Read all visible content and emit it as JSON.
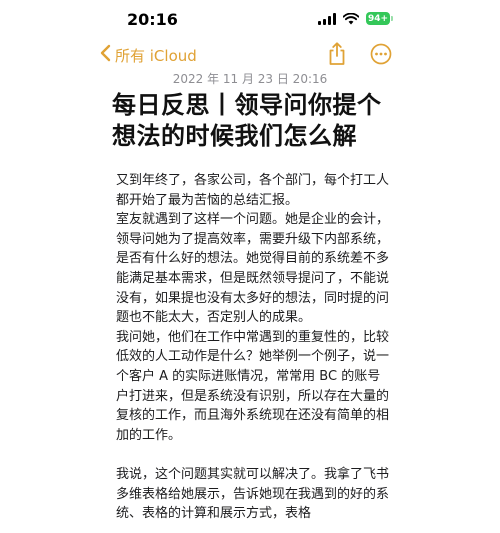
{
  "status_bar": {
    "time": "20:16",
    "battery": "94+",
    "icons": [
      "cellular-signal-icon",
      "wifi-icon",
      "battery-icon"
    ]
  },
  "nav": {
    "back_label": "所有 iCloud",
    "back_icon": "chevron-left-icon",
    "share_icon": "share-icon",
    "more_icon": "more-icon",
    "accent_color": "#e0a235"
  },
  "note": {
    "date": "2022 年 11 月 23 日 20:16",
    "title": "每日反思丨领导问你提个想法的时候我们怎么解",
    "paragraphs": [
      "又到年终了，各家公司，各个部门，每个打工人都开始了最为苦恼的总结汇报。",
      "室友就遇到了这样一个问题。她是企业的会计，领导问她为了提高效率，需要升级下内部系统，是否有什么好的想法。她觉得目前的系统差不多能满足基本需求，但是既然领导提问了，不能说没有，如果提也没有太多好的想法，同时提的问题也不能太大，否定别人的成果。",
      "我问她，他们在工作中常遇到的重复性的，比较低效的人工动作是什么？她举例一个例子，说一个客户 A 的实际进账情况，常常用 BC 的账号户打进来，但是系统没有识别，所以存在大量的复核的工作，而且海外系统现在还没有简单的相加的工作。",
      "我说，这个问题其实就可以解决了。我拿了飞书多维表格给她展示，告诉她现在我遇到的好的系统、表格的计算和展示方式，表格"
    ]
  }
}
